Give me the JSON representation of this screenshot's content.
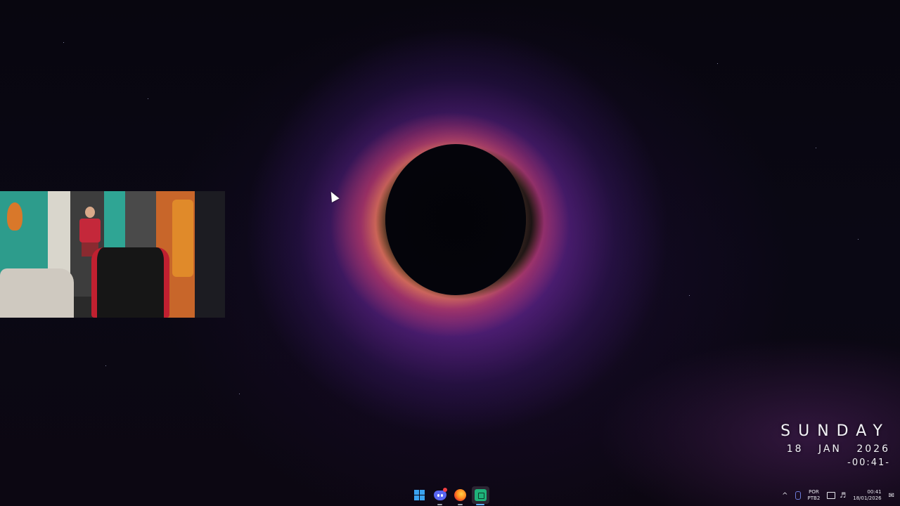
{
  "widget": {
    "day": "SUNDAY",
    "date_day": "18",
    "date_month": "JAN",
    "date_year": "2026",
    "time": "-00:41-"
  },
  "taskbar": {
    "apps": [
      {
        "name": "Start",
        "icon": "windows-logo-icon"
      },
      {
        "name": "Discord",
        "icon": "discord-icon",
        "badge": true
      },
      {
        "name": "Firefox",
        "icon": "firefox-icon"
      },
      {
        "name": "App",
        "icon": "green-app-icon",
        "active": true
      }
    ],
    "accent": "#5fb2ff"
  },
  "tray": {
    "chevron": "^",
    "lang_line1": "POR",
    "lang_line2": "PTB2",
    "time": "00:41",
    "date": "18/01/2026"
  }
}
